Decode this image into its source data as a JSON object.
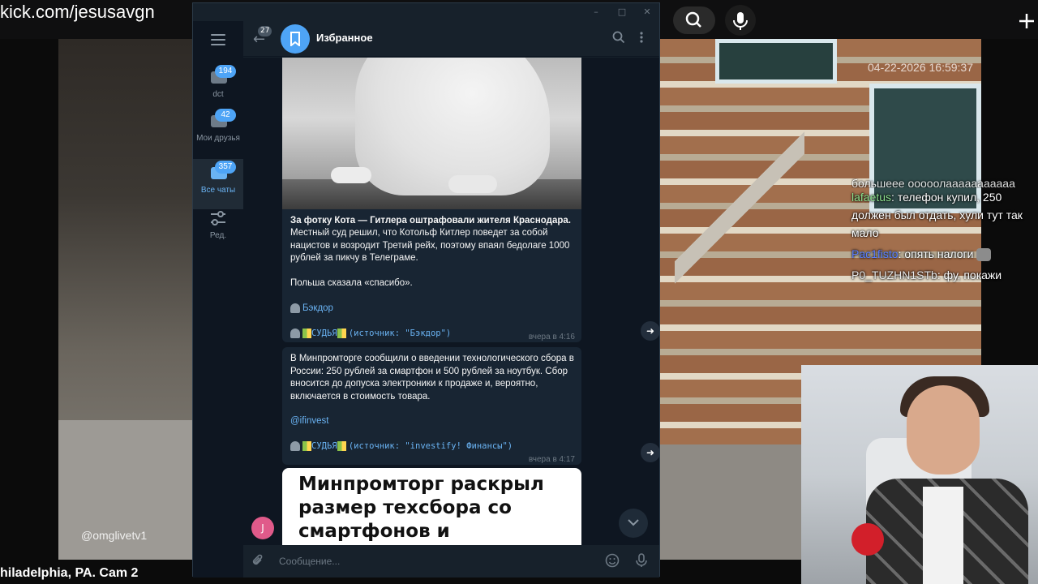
{
  "browser": {
    "url": "kick.com/jesusavgn"
  },
  "stream": {
    "timestamp": "04-22-2026 16:59:37",
    "watermark": "@omglivetv1",
    "caption": "hiladelphia, PA. Cam 2"
  },
  "chat": {
    "cutoff_text": "большеее ооооолааааааааааа",
    "messages": [
      {
        "user": "lafaetus",
        "text": ": телефон купил, 250 должен был отдать, хули тут так мало"
      },
      {
        "user": "Pac1fisto",
        "text": ": опять налоги"
      },
      {
        "user": "P0_TUZHN1STb",
        "text": ": фу, покажи"
      }
    ]
  },
  "telegram": {
    "window_buttons": [
      "–",
      "□",
      "✕"
    ],
    "sidebar": {
      "items": [
        {
          "label": "dct",
          "badge": "194"
        },
        {
          "label": "Мои друзья",
          "badge": "42"
        },
        {
          "label": "Все чаты",
          "badge": "357"
        },
        {
          "label": "Ред.",
          "badge": ""
        }
      ]
    },
    "header": {
      "title": "Избранное",
      "back_badge": "27"
    },
    "messages": [
      {
        "title": "За фотку Кота — Гитлера оштрафовали жителя Краснодара.",
        "body": "Местный суд решил, что Котольф Китлер поведет за собой нацистов и возродит Третий рейх, поэтому впаял бедолаге 1000 рублей за пикчу в Телеграме.",
        "extra": "Польша сказала «спасибо».",
        "link": "Бэкдор",
        "signature": "СУДЬЯ",
        "source": "(источник: \"Бэкдор\")",
        "time": "вчера в 4:16"
      },
      {
        "body": "В Минпромторге сообщили о введении технологического сбора в России: 250 рублей за смартфон и 500 рублей за ноутбук. Сбор вносится до допуска электроники к продаже и, вероятно, включается в стоимость товара.",
        "link": "@ifinvest",
        "signature": "СУДЬЯ",
        "source": "(источник: \"investify! Финансы\")",
        "time": "вчера в 4:17"
      }
    ],
    "card_text": "Минпромторг раскрыл размер техсбора со смартфонов и",
    "user_initial": "J",
    "input_placeholder": "Сообщение..."
  },
  "colors": {
    "accent": "#4ea4f6",
    "bg": "#0e1621",
    "bubble": "#182533",
    "link": "#6ab3f3"
  }
}
